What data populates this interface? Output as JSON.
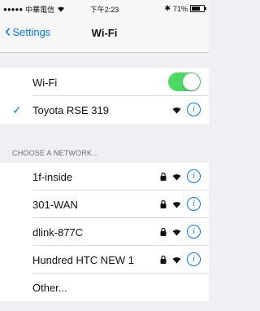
{
  "status_bar": {
    "carrier": "中華電信",
    "time": "下午2:23",
    "battery": "71%",
    "battery_level": 0.71
  },
  "nav": {
    "back_label": "Settings",
    "title": "Wi-Fi"
  },
  "wifi_toggle": {
    "label": "Wi-Fi",
    "on": true
  },
  "connected": {
    "name": "Toyota RSE 319"
  },
  "section_header": "CHOOSE A NETWORK...",
  "networks": [
    {
      "name": "1f-inside",
      "secured": true
    },
    {
      "name": "301-WAN",
      "secured": true
    },
    {
      "name": "dlink-877C",
      "secured": true
    },
    {
      "name": "Hundred HTC NEW 1",
      "secured": true
    },
    {
      "name": "Other..."
    }
  ]
}
